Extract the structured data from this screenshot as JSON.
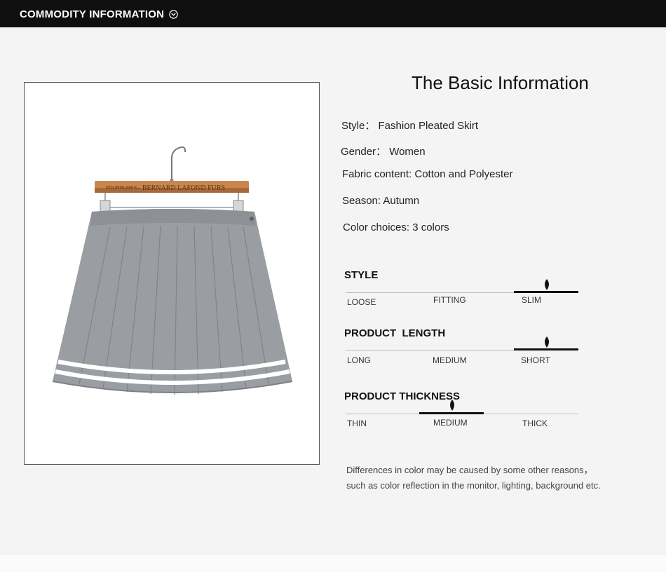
{
  "header": {
    "title": "COMMODITY INFORMATION",
    "icon": "chevron-down-circle-icon"
  },
  "product_image": {
    "hanger_brand_small": "FOURRURES",
    "hanger_brand": "- BERNARD LAFOND FURS",
    "colors": {
      "skirt": "#9a9ea3",
      "stripe": "#ffffff",
      "hanger": "#c9874d"
    }
  },
  "basic_info": {
    "title": "The Basic Information",
    "rows": [
      "Style： Fashion Pleated Skirt",
      "Gender： Women",
      "Fabric content: Cotton and Polyester",
      "Season: Autumn",
      "Color choices: 3 colors"
    ]
  },
  "scales": [
    {
      "title": "STYLE",
      "labels": [
        "LOOSE",
        "FITTING",
        "SLIM"
      ],
      "selected": "SLIM"
    },
    {
      "title": "PRODUCT  LENGTH",
      "labels": [
        "LONG",
        "MEDIUM",
        "SHORT"
      ],
      "selected": "SHORT"
    },
    {
      "title": "PRODUCT THICKNESS",
      "labels": [
        "THIN",
        "MEDIUM",
        "THICK"
      ],
      "selected": "MEDIUM"
    }
  ],
  "note": {
    "line1": "Differences in color may be caused by some other reasons，",
    "line2": "such as color reflection in the monitor, lighting, background etc."
  }
}
